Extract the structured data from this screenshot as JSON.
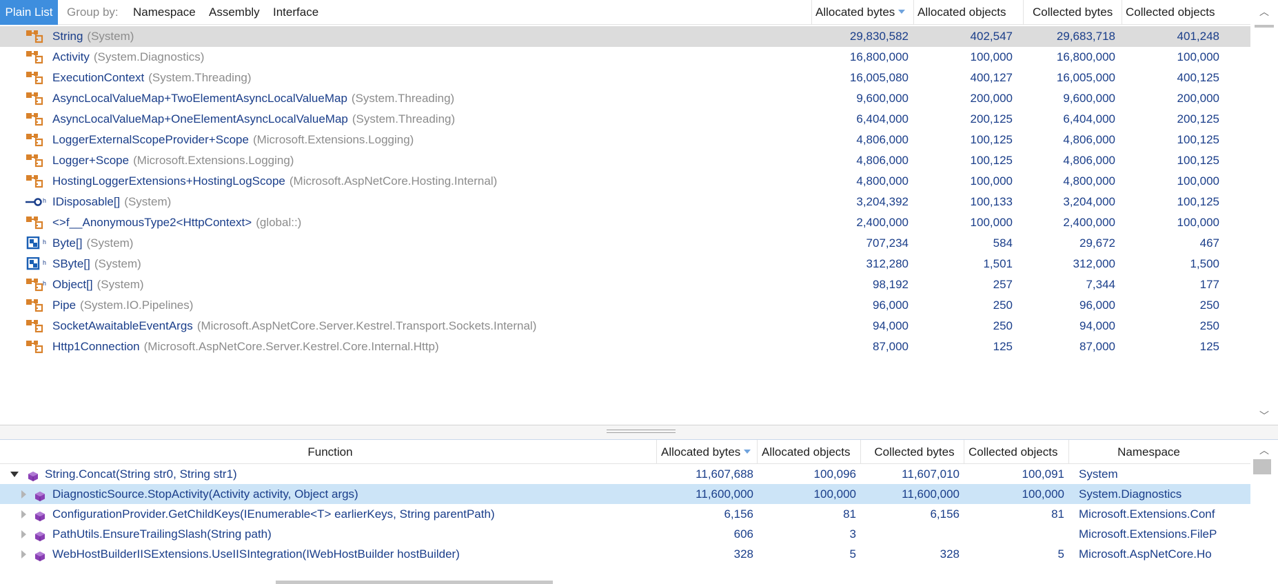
{
  "grouping": {
    "plain_list": "Plain List",
    "group_by_label": "Group by:",
    "options": [
      "Namespace",
      "Assembly",
      "Interface"
    ]
  },
  "top_columns": {
    "allocated_bytes": "Allocated bytes",
    "allocated_objects": "Allocated objects",
    "collected_bytes": "Collected bytes",
    "collected_objects": "Collected objects"
  },
  "types": [
    {
      "name": "String",
      "ns": "(System)",
      "icon": "class-icon",
      "gen": "",
      "ab": "29,830,582",
      "ao": "402,547",
      "cb": "29,683,718",
      "co": "401,248"
    },
    {
      "name": "Activity",
      "ns": "(System.Diagnostics)",
      "icon": "class-icon",
      "gen": "",
      "ab": "16,800,000",
      "ao": "100,000",
      "cb": "16,800,000",
      "co": "100,000"
    },
    {
      "name": "ExecutionContext",
      "ns": "(System.Threading)",
      "icon": "class-icon",
      "gen": "",
      "ab": "16,005,080",
      "ao": "400,127",
      "cb": "16,005,000",
      "co": "400,125"
    },
    {
      "name": "AsyncLocalValueMap+TwoElementAsyncLocalValueMap",
      "ns": "(System.Threading)",
      "icon": "class-icon",
      "gen": "",
      "ab": "9,600,000",
      "ao": "200,000",
      "cb": "9,600,000",
      "co": "200,000"
    },
    {
      "name": "AsyncLocalValueMap+OneElementAsyncLocalValueMap",
      "ns": "(System.Threading)",
      "icon": "class-icon",
      "gen": "",
      "ab": "6,404,000",
      "ao": "200,125",
      "cb": "6,404,000",
      "co": "200,125"
    },
    {
      "name": "LoggerExternalScopeProvider+Scope",
      "ns": "(Microsoft.Extensions.Logging)",
      "icon": "class-icon",
      "gen": "",
      "ab": "4,806,000",
      "ao": "100,125",
      "cb": "4,806,000",
      "co": "100,125"
    },
    {
      "name": "Logger+Scope",
      "ns": "(Microsoft.Extensions.Logging)",
      "icon": "class-icon",
      "gen": "",
      "ab": "4,806,000",
      "ao": "100,125",
      "cb": "4,806,000",
      "co": "100,125"
    },
    {
      "name": "HostingLoggerExtensions+HostingLogScope",
      "ns": "(Microsoft.AspNetCore.Hosting.Internal)",
      "icon": "class-icon",
      "gen": "",
      "ab": "4,800,000",
      "ao": "100,000",
      "cb": "4,800,000",
      "co": "100,000"
    },
    {
      "name": "IDisposable[]",
      "ns": "(System)",
      "icon": "interface-icon",
      "gen": "ʰ",
      "ab": "3,204,392",
      "ao": "100,133",
      "cb": "3,204,000",
      "co": "100,125"
    },
    {
      "name": "<>f__AnonymousType2<HttpContext>",
      "ns": "(global::)",
      "icon": "class-icon",
      "gen": "",
      "ab": "2,400,000",
      "ao": "100,000",
      "cb": "2,400,000",
      "co": "100,000"
    },
    {
      "name": "Byte[]",
      "ns": "(System)",
      "icon": "struct-icon",
      "gen": "ʰ",
      "ab": "707,234",
      "ao": "584",
      "cb": "29,672",
      "co": "467"
    },
    {
      "name": "SByte[]",
      "ns": "(System)",
      "icon": "struct-icon",
      "gen": "ʰ",
      "ab": "312,280",
      "ao": "1,501",
      "cb": "312,000",
      "co": "1,500"
    },
    {
      "name": "Object[]",
      "ns": "(System)",
      "icon": "class-icon",
      "gen": "ʰ",
      "ab": "98,192",
      "ao": "257",
      "cb": "7,344",
      "co": "177"
    },
    {
      "name": "Pipe",
      "ns": "(System.IO.Pipelines)",
      "icon": "class-icon",
      "gen": "",
      "ab": "96,000",
      "ao": "250",
      "cb": "96,000",
      "co": "250"
    },
    {
      "name": "SocketAwaitableEventArgs",
      "ns": "(Microsoft.AspNetCore.Server.Kestrel.Transport.Sockets.Internal)",
      "icon": "class-icon",
      "gen": "",
      "ab": "94,000",
      "ao": "250",
      "cb": "94,000",
      "co": "250"
    },
    {
      "name": "Http1Connection",
      "ns": "(Microsoft.AspNetCore.Server.Kestrel.Core.Internal.Http)",
      "icon": "class-icon",
      "gen": "",
      "ab": "87,000",
      "ao": "125",
      "cb": "87,000",
      "co": "125"
    }
  ],
  "bottom_columns": {
    "function": "Function",
    "allocated_bytes": "Allocated bytes",
    "allocated_objects": "Allocated objects",
    "collected_bytes": "Collected bytes",
    "collected_objects": "Collected objects",
    "namespace": "Namespace"
  },
  "functions": [
    {
      "name": "String.Concat(String str0, String str1)",
      "level": 0,
      "expanded": true,
      "ab": "11,607,688",
      "ao": "100,096",
      "cb": "11,607,010",
      "co": "100,091",
      "ns": "System"
    },
    {
      "name": "DiagnosticSource.StopActivity(Activity activity, Object args)",
      "level": 1,
      "expanded": false,
      "ab": "11,600,000",
      "ao": "100,000",
      "cb": "11,600,000",
      "co": "100,000",
      "ns": "System.Diagnostics"
    },
    {
      "name": "ConfigurationProvider.GetChildKeys(IEnumerable<T> earlierKeys, String parentPath)",
      "level": 1,
      "expanded": false,
      "ab": "6,156",
      "ao": "81",
      "cb": "6,156",
      "co": "81",
      "ns": "Microsoft.Extensions.Conf"
    },
    {
      "name": "PathUtils.EnsureTrailingSlash(String path)",
      "level": 1,
      "expanded": false,
      "ab": "606",
      "ao": "3",
      "cb": "",
      "co": "",
      "ns": "Microsoft.Extensions.FileP"
    },
    {
      "name": "WebHostBuilderIISExtensions.UseIISIntegration(IWebHostBuilder hostBuilder)",
      "level": 1,
      "expanded": false,
      "ab": "328",
      "ao": "5",
      "cb": "328",
      "co": "5",
      "ns": "Microsoft.AspNetCore.Ho"
    }
  ],
  "colors": {
    "accent": "#3e8ede",
    "row_selected_grey": "#dcdcdc",
    "row_selected_blue": "#cce4f7",
    "class_icon": "#d9822b",
    "method_icon": "#8a3fb5",
    "text_primary": "#1a3e8a",
    "text_namespace": "#8c8c8c"
  }
}
